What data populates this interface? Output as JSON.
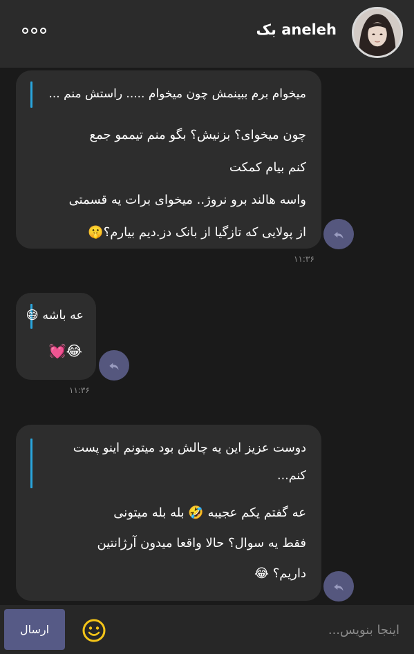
{
  "header": {
    "contact_name": "aneleh بک",
    "menu_icon": "more-options-icon",
    "avatar_icon": "contact-avatar"
  },
  "messages": [
    {
      "quote": "میخوام برم ببینمش چون میخوام ..... راستش منم ...",
      "text": "چون میخوای؟ بزنیش؟ بگو منم تیممو جمع\nکنم بیام کمکت\nواسه هالند برو نروژ.. میخوای برات یه قسمتی\nاز پولایی که تازگیا از بانک دز.دیم بیارم؟🤫",
      "time": "۱۱:۳۶"
    },
    {
      "quote": "عه باشه 😅",
      "text": "😂💓",
      "time": "۱۱:۳۶"
    },
    {
      "quote": "دوست عزیز این یه چالش بود میتونم اینو پست\nکنم...",
      "text": "عه گفتم یکم عجیبه 🤣 بله بله میتونی\nفقط یه سوال؟ حالا واقعا میدون آرژانتین\nداریم؟ 😂",
      "time": ""
    }
  ],
  "composer": {
    "send_label": "ارسال",
    "placeholder": "اینجا بنویس...",
    "emoji_icon": "smiley-icon"
  },
  "colors": {
    "background": "#1a1a1a",
    "header": "#2b2b2b",
    "bubble": "#2d2d2d",
    "quote_bar": "#29a6de",
    "reply_button": "#55577e",
    "send_button": "#565a86",
    "emoji_yellow": "#f5c518"
  }
}
